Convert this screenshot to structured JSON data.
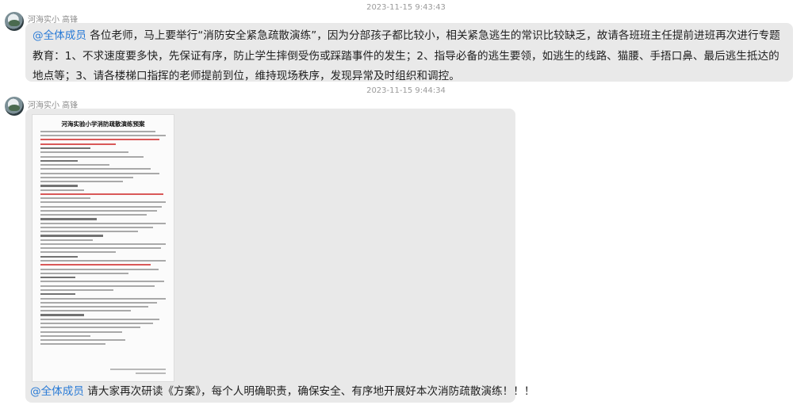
{
  "messages": [
    {
      "timestamp": "2023-11-15 9:43:43",
      "sender": "河海实小 高锋",
      "mention": "@全体成员",
      "text": " 各位老师，马上要举行“消防安全紧急疏散演练”，因为分部孩子都比较小，相关紧急逃生的常识比较缺乏，故请各班班主任提前进班再次进行专题教育：1、不求速度要多快，先保证有序，防止学生摔倒受伤或踩踏事件的发生；2、指导必备的逃生要领，如逃生的线路、猫腰、手捂口鼻、最后逃生抵达的地点等；3、请各楼梯口指挥的老师提前到位，维持现场秩序，发现异常及时组织和调控。"
    },
    {
      "timestamp": "2023-11-15 9:44:34",
      "sender": "河海实小 高锋",
      "image": {
        "doc_title": "河海实验小学消防疏散演练预案"
      },
      "mention": "@全体成员",
      "text": " 请大家再次研读《方案》，每个人明确职责，确保安全、有序地开展好本次消防疏散演练！！！"
    }
  ],
  "colors": {
    "bubble_bg": "#e9e9e9",
    "mention": "#2a7bd6",
    "timestamp": "#9a9a9a"
  },
  "icons": {
    "avatar": "avatar-icon"
  }
}
